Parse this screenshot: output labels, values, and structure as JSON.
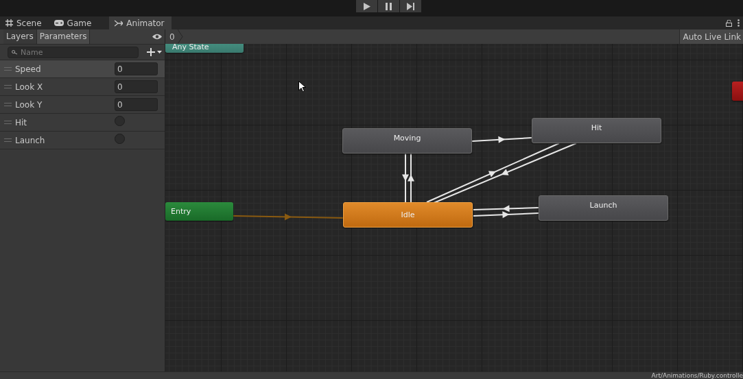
{
  "tabs": [
    {
      "label": "Scene",
      "selected": false
    },
    {
      "label": "Game",
      "selected": false
    },
    {
      "label": "Animator",
      "selected": true
    }
  ],
  "left_panel": {
    "subtabs": [
      {
        "label": "Layers",
        "selected": false
      },
      {
        "label": "Parameters",
        "selected": true
      }
    ],
    "search": {
      "placeholder": "Name"
    },
    "parameters": [
      {
        "name": "Speed",
        "kind": "float",
        "value": "0",
        "selected": true
      },
      {
        "name": "Look X",
        "kind": "float",
        "value": "0",
        "selected": false
      },
      {
        "name": "Look Y",
        "kind": "float",
        "value": "0",
        "selected": false
      },
      {
        "name": "Hit",
        "kind": "trigger",
        "selected": false
      },
      {
        "name": "Launch",
        "kind": "trigger",
        "selected": false
      }
    ]
  },
  "graph": {
    "breadcrumb": "0",
    "auto_live_link": "Auto Live Link",
    "nodes": [
      {
        "label": "Any State",
        "kind": "any"
      },
      {
        "label": "Moving",
        "kind": "state"
      },
      {
        "label": "Hit",
        "kind": "state"
      },
      {
        "label": "Entry",
        "kind": "entry"
      },
      {
        "label": "Idle",
        "kind": "default"
      },
      {
        "label": "Launch",
        "kind": "state"
      },
      {
        "kind": "exit"
      }
    ]
  },
  "status_bar": {
    "path": "Art/Animations/Ruby.controlle"
  }
}
